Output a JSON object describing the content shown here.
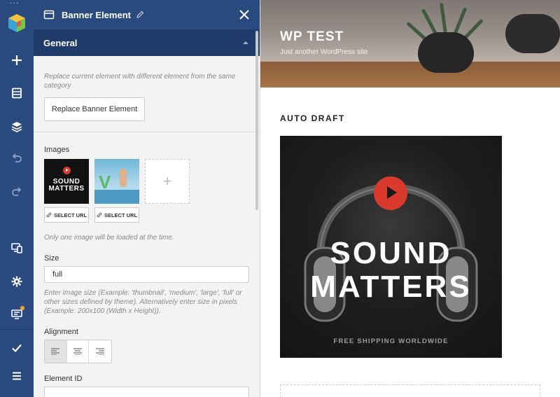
{
  "rail": {
    "items": [
      "logo-icon",
      "add-icon",
      "layout-icon",
      "layers-icon",
      "undo-icon",
      "redo-icon",
      "responsive-icon",
      "settings-icon",
      "templates-icon",
      "save-icon",
      "menu-icon"
    ]
  },
  "panel": {
    "title": "Banner Element",
    "section": "General",
    "replace_hint": "Replace current element with different element from the same category",
    "replace_button": "Replace Banner Element",
    "images_label": "Images",
    "image1_text": "SOUND MATTERS",
    "image2_text": "V",
    "add_image": "+",
    "select_url": "SELECT URL",
    "images_hint": "Only one image will be loaded at the time.",
    "size_label": "Size",
    "size_value": "full",
    "size_hint": "Enter image size (Example: 'thumbnail', 'medium', 'large', 'full' or other sizes defined by theme). Alternatively enter size in pixels (Example: 200x100 (Width x Height)).",
    "alignment_label": "Alignment",
    "alignment_selected": "left",
    "element_id_label": "Element ID",
    "element_id_value": ""
  },
  "site": {
    "title": "WP TEST",
    "tagline": "Just another WordPress site",
    "post_title": "AUTO DRAFT",
    "banner_line1": "SOUND",
    "banner_line2": "MATTERS",
    "banner_subtitle": "FREE SHIPPING WORLDWIDE"
  },
  "colors": {
    "rail": "#2a4a7f",
    "section_bar": "#1f3b6a",
    "play_red": "#d93a2b",
    "notification_dot": "#f5a623"
  }
}
